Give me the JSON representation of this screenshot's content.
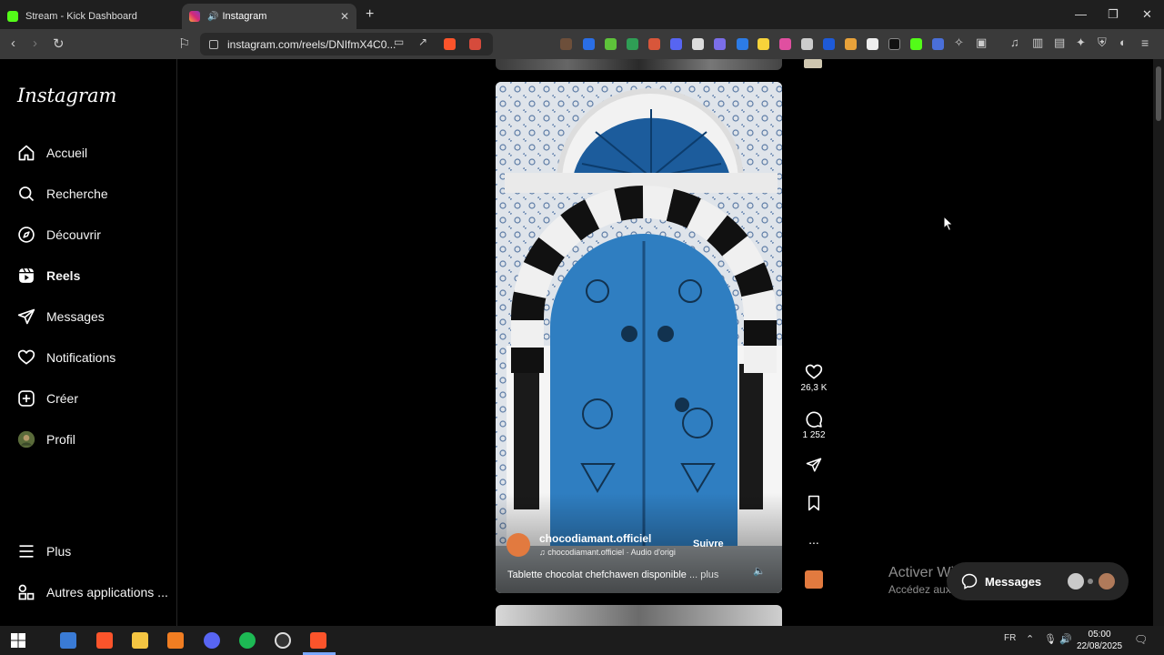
{
  "browser": {
    "tabs": [
      {
        "title": "Stream - Kick Dashboard",
        "active": false
      },
      {
        "title": "Instagram",
        "active": true
      }
    ],
    "url": "instagram.com/reels/DNIfmX4C0...",
    "new_tab_label": "+",
    "close_tab_label": "✕",
    "window_controls": [
      "—",
      "❐",
      "✕"
    ]
  },
  "instagram": {
    "logo": "Instagram",
    "nav": [
      {
        "label": "Accueil",
        "icon": "home-icon"
      },
      {
        "label": "Recherche",
        "icon": "search-icon"
      },
      {
        "label": "Découvrir",
        "icon": "explore-icon"
      },
      {
        "label": "Reels",
        "icon": "reels-icon"
      },
      {
        "label": "Messages",
        "icon": "messages-icon"
      },
      {
        "label": "Notifications",
        "icon": "heart-icon"
      },
      {
        "label": "Créer",
        "icon": "create-icon"
      },
      {
        "label": "Profil",
        "icon": "profile-icon"
      }
    ],
    "bottom_nav": [
      {
        "label": "Plus",
        "icon": "menu-icon"
      },
      {
        "label": "Autres applications ...",
        "icon": "apps-icon"
      }
    ],
    "reel": {
      "author": "chocodiamant.officiel",
      "audio": "chocodiamant.officiel · Audio d'origine",
      "follow_label": "Suivre",
      "caption": "Tablette chocolat chefchawen disponible",
      "caption_more": "... plus",
      "likes": "26,3 K",
      "comments": "1 252",
      "more_label": "..."
    },
    "messages_pill": "Messages"
  },
  "watermark": {
    "line1": "Activer Windows",
    "line2": "Accédez aux paramètres pour activer Windows."
  },
  "taskbar": {
    "language": "FR",
    "time": "05:00",
    "date": "22/08/2025"
  },
  "colors": {
    "accent_door": "#2f7ec1",
    "kick_green": "#53fc18",
    "avatar_orange": "#e27a3f"
  }
}
